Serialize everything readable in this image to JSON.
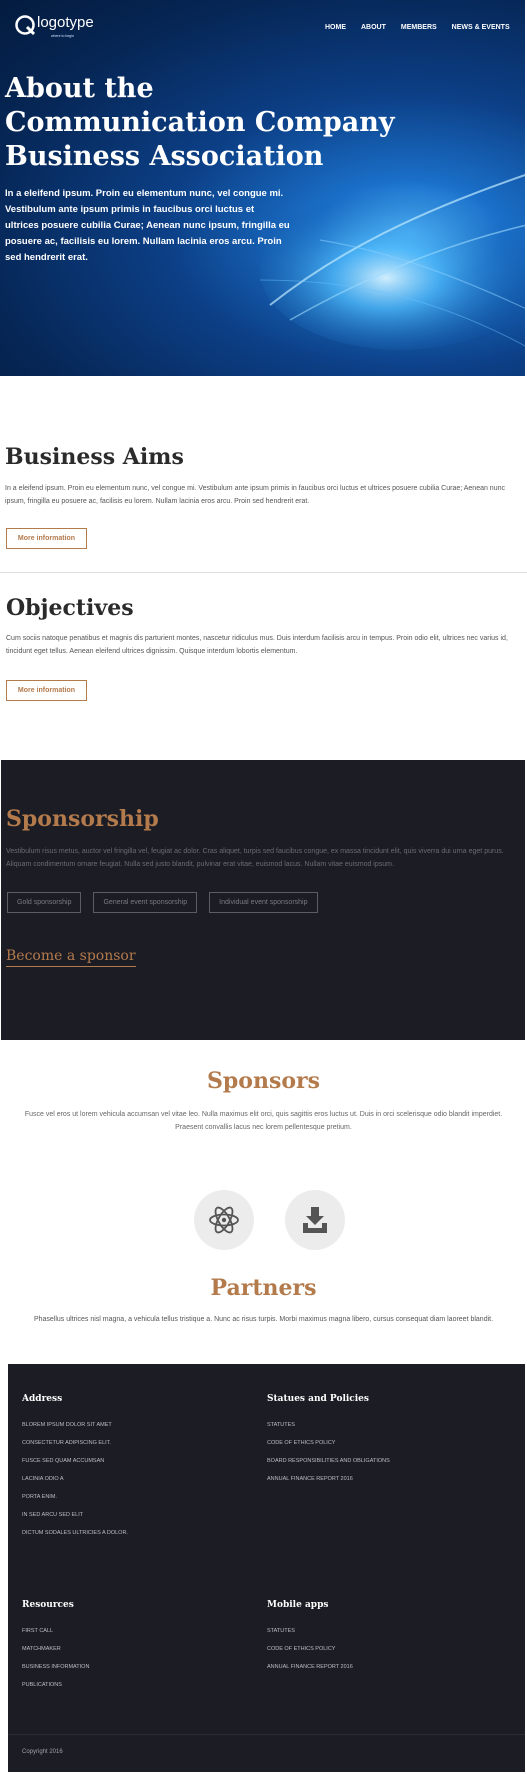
{
  "header": {
    "logo_text": "logotype",
    "logo_tagline": "where to begin",
    "nav": [
      "HOME",
      "ABOUT",
      "MEMBERS",
      "NEWS & EVENTS"
    ]
  },
  "hero": {
    "title_lines": [
      "About the",
      "Communication Company",
      "Business Association"
    ],
    "text": "In a eleifend ipsum. Proin eu elementum nunc, vel congue mi. Vestibulum ante ipsum primis in faucibus orci luctus et ultrices posuere cubilia Curae; Aenean nunc ipsum, fringilla eu posuere ac, facilisis eu lorem. Nullam lacinia eros arcu. Proin sed hendrerit erat."
  },
  "business_aims": {
    "title": "Business Aims",
    "text": "In a eleifend ipsum. Proin eu elementum nunc, vel congue mi. Vestibulum ante ipsum primis in faucibus orci luctus et ultrices posuere cubilia Curae; Aenean nunc ipsum, fringilla eu posuere ac, facilisis eu lorem. Nullam lacinia eros arcu. Proin sed hendrerit erat.",
    "button": "More information"
  },
  "objectives": {
    "title": "Objectives",
    "text": "Cum sociis natoque penatibus et magnis dis parturient montes, nascetur ridiculus mus. Duis interdum facilisis arcu in tempus. Proin odio elit, ultrices nec varius id, tincidunt eget tellus. Aenean eleifend ultrices dignissim. Quisque interdum lobortis elementum.",
    "button": "More information"
  },
  "sponsorship": {
    "title": "Sponsorship",
    "text": "Vestibulum risus metus, auctor vel fringilla vel, feugiat ac dolor. Cras aliquet, turpis sed faucibus congue, ex massa tincidunt elit, quis viverra dui urna eget purus. Aliquam condimentum ornare feugiat. Nulla sed justo blandit, pulvinar erat vitae, euismod lacus. Nullam vitae euismod ipsum.",
    "tags": [
      "Gold sponsorship",
      "General event sponsorship",
      "Individual event sponsorship"
    ],
    "link": "Become a sponsor"
  },
  "sponsors": {
    "title": "Sponsors",
    "text": "Fusce vel eros ut lorem vehicula accumsan vel vitae leo. Nulla maximus elit orci, quis sagittis eros luctus ut. Duis in orci scelerisque odio blandit imperdiet. Praesent convallis lacus nec lorem pellentesque pretium.",
    "icons": [
      "atom-icon",
      "download-tray-icon"
    ]
  },
  "partners": {
    "title": "Partners",
    "text": "Phasellus ultrices nisl magna, a vehicula tellus tristique a. Nunc ac risus turpis. Morbi maximus magna libero, cursus consequat diam laoreet blandit."
  },
  "footer": {
    "address": {
      "title": "Address",
      "items": [
        "Blorem ipsum dolor sit amet",
        "Consectetur adipiscing elit.",
        "Fusce sed quam accumsan",
        "Lacinia odio a",
        "Porta enim.",
        "In sed arcu sed elit",
        "Dictum sodales ultricies a dolor."
      ]
    },
    "statues": {
      "title": "Statues and Policies",
      "items": [
        "Statutes",
        "Code of ethics policy",
        "Board responsibilities and obligations",
        "Annual finance report 2016"
      ]
    },
    "resources": {
      "title": "Resources",
      "items": [
        "First call",
        "Matchmaker",
        "Business information",
        "Publications"
      ]
    },
    "mobile": {
      "title": "Mobile apps",
      "items": [
        "Statutes",
        "Code of ethics policy",
        "Annual finance report 2016"
      ]
    },
    "copyright": "Copyright 2016"
  },
  "colors": {
    "accent": "#b37a4c",
    "dark": "#1c1c24",
    "hero": "#0c3f86"
  }
}
